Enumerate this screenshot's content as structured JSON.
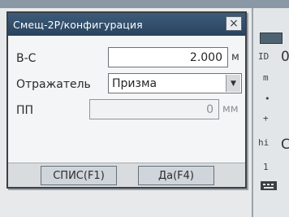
{
  "dialog": {
    "title": "Смещ-2Р/конфигурация",
    "close_glyph": "×",
    "fields": {
      "vs": {
        "label": "В-С",
        "value": "2.000",
        "unit": "м"
      },
      "reflector": {
        "label": "Отражатель",
        "value": "Призма",
        "dropdown_glyph": "▼"
      },
      "pp": {
        "label": "ПП",
        "value": "0",
        "unit": "мм"
      }
    },
    "buttons": {
      "list_label": "СПИС(F1)",
      "ok_label": "Да(F4)"
    }
  },
  "side_panel": {
    "glyphs": [
      "ID",
      "m",
      "•",
      "+",
      "hi",
      "1"
    ],
    "partial_text": [
      "0",
      "C"
    ]
  },
  "colors": {
    "titlebar": "#2f4d6b",
    "dialog_bg": "#f4f5f6",
    "screen_bg": "#e7e9ea"
  }
}
